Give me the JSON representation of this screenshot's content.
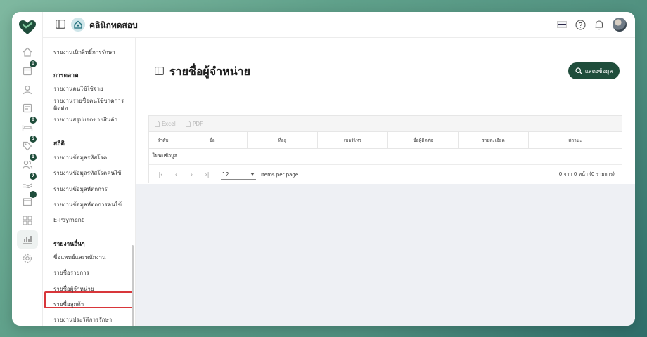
{
  "header": {
    "clinic_name": "คลินิกทดสอบ",
    "flag_colors": [
      "#a51931",
      "#f4f5f8",
      "#2d2a4a",
      "#f4f5f8",
      "#a51931"
    ]
  },
  "rail": {
    "items": [
      {
        "icon": "home-icon"
      },
      {
        "icon": "calendar-icon",
        "badge": "0"
      },
      {
        "icon": "user-icon"
      },
      {
        "icon": "document-icon"
      },
      {
        "icon": "bed-icon",
        "badge": "0"
      },
      {
        "icon": "tag-icon",
        "badge": "5"
      },
      {
        "icon": "group-icon",
        "badge": "1"
      },
      {
        "icon": "hand-icon",
        "badge": "7"
      },
      {
        "icon": "box-icon",
        "badge": ""
      },
      {
        "icon": "grid-icon"
      },
      {
        "icon": "chart-icon",
        "active": true
      },
      {
        "icon": "gear-icon"
      }
    ]
  },
  "menu": {
    "top_item": "รายงานเบิกสิทธิ์การรักษา",
    "marketing_heading": "การตลาด",
    "marketing_items": [
      "รายงานคนใช้ใช้จ่าย",
      "รายงานรายชื่อคนใช้ขาดการติดต่อ",
      "รายงานสรุปยอดขายสินค้า"
    ],
    "stats_heading": "สถิติ",
    "stats_items": [
      "รายงานข้อมูลรหัสโรค",
      "รายงานข้อมูลรหัสโรคคนไข้",
      "รายงานข้อมูลหัตถการ",
      "รายงานข้อมูลหัตถการคนไข้",
      "E-Payment"
    ],
    "other_heading": "รายงานอื่นๆ",
    "other_items": [
      "ชื่อแพทย์และพนักงาน",
      "รายชื่อรายการ",
      "รายชื่อผู้จำหน่าย",
      "รายชื่อลูกค้า",
      "รายงานประวัติการรักษา"
    ]
  },
  "main": {
    "title": "รายชื่อผู้จำหน่าย",
    "show_button": "แสดงข้อมูล",
    "export_excel": "Excel",
    "export_pdf": "PDF",
    "columns": [
      "ลำดับ",
      "ชื่อ",
      "ที่อยู่",
      "เบอร์โทร",
      "ชื่อผู้ติดต่อ",
      "รายละเอียด",
      "สถานะ"
    ],
    "no_data": "ไม่พบข้อมูล",
    "page_size": "12",
    "items_per_page_label": "Items per page",
    "range_text": "0 จาก 0 หน้า (0 รายการ)"
  }
}
